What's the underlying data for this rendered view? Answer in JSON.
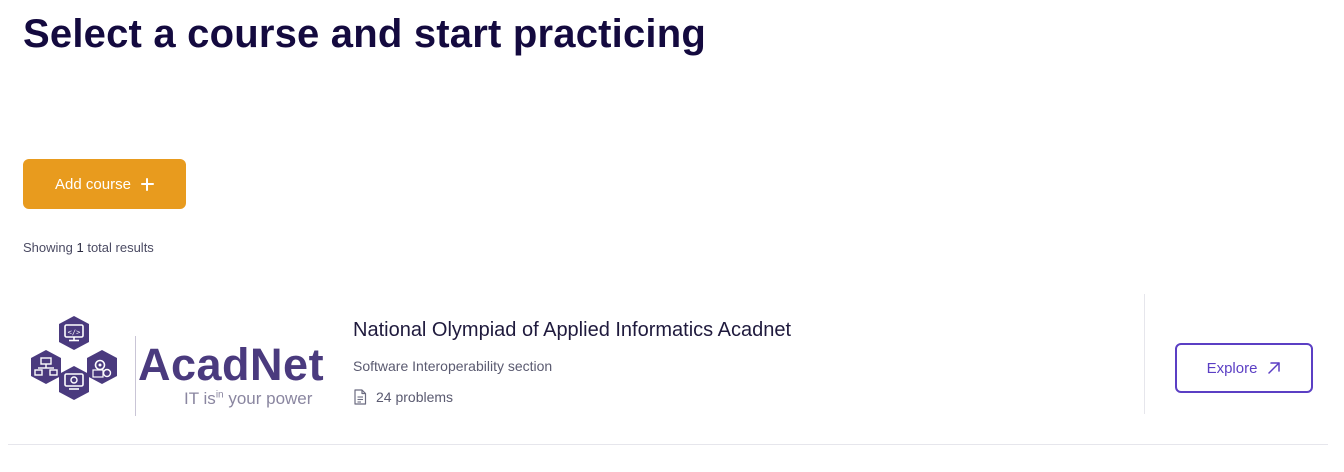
{
  "header": {
    "title": "Select a course and start practicing"
  },
  "toolbar": {
    "add_course_label": "Add course",
    "add_course_icon": "plus-icon"
  },
  "results": {
    "prefix": "Showing ",
    "count": "1",
    "suffix": " total results"
  },
  "courses": [
    {
      "logo": {
        "word": "AcadNet",
        "tag_prefix": "IT is",
        "tag_sup": "in",
        "tag_suffix": " your power"
      },
      "title": "National Olympiad of Applied Informatics Acadnet",
      "subtitle": "Software Interoperability section",
      "problems": "24 problems",
      "problems_icon": "document-icon",
      "explore_label": "Explore",
      "explore_icon": "arrow-up-right-icon"
    }
  ],
  "colors": {
    "title": "#140a3f",
    "primary_button": "#e89b1e",
    "accent": "#5b3fc4",
    "logo": "#4a3a7e"
  }
}
